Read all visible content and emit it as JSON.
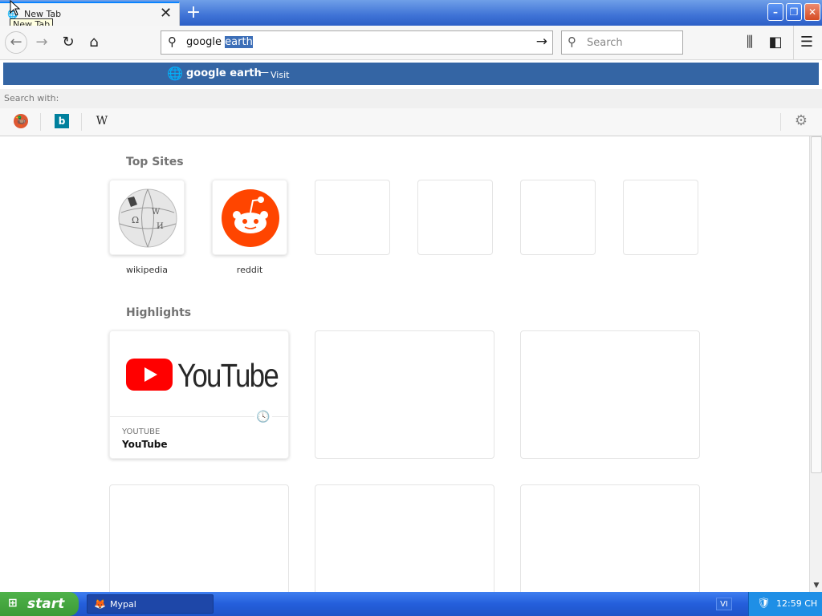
{
  "tab": {
    "title": "New Tab",
    "tooltip": "New Tab"
  },
  "toolbar": {
    "url_typed": "google ",
    "url_selected": "earth",
    "search_placeholder": "Search"
  },
  "suggestion": {
    "text": "google earth",
    "separator": "—",
    "action": "Visit"
  },
  "search_with": {
    "label": "Search with:",
    "engines": [
      {
        "icon": "duckduckgo-icon",
        "color": "#de5833"
      },
      {
        "icon": "bing-icon",
        "color": "#00809d",
        "glyph": "b"
      },
      {
        "icon": "wikipedia-icon",
        "glyph": "W"
      }
    ]
  },
  "top_sites": {
    "heading": "Top Sites",
    "items": [
      {
        "label": "wikipedia"
      },
      {
        "label": "reddit"
      },
      {
        "label": ""
      },
      {
        "label": ""
      },
      {
        "label": ""
      },
      {
        "label": ""
      }
    ]
  },
  "highlights": {
    "heading": "Highlights",
    "cards": [
      {
        "source": "YOUTUBE",
        "title": "YouTube",
        "logo_text": "YouTube"
      }
    ]
  },
  "taskbar": {
    "start_label": "start",
    "app_label": "Mypal",
    "language": "VI",
    "clock": "12:59 CH"
  },
  "colors": {
    "accent": "#0a84ff",
    "suggestion_bg": "#3465a4",
    "reddit": "#ff4500",
    "youtube_red": "#ff0000"
  }
}
